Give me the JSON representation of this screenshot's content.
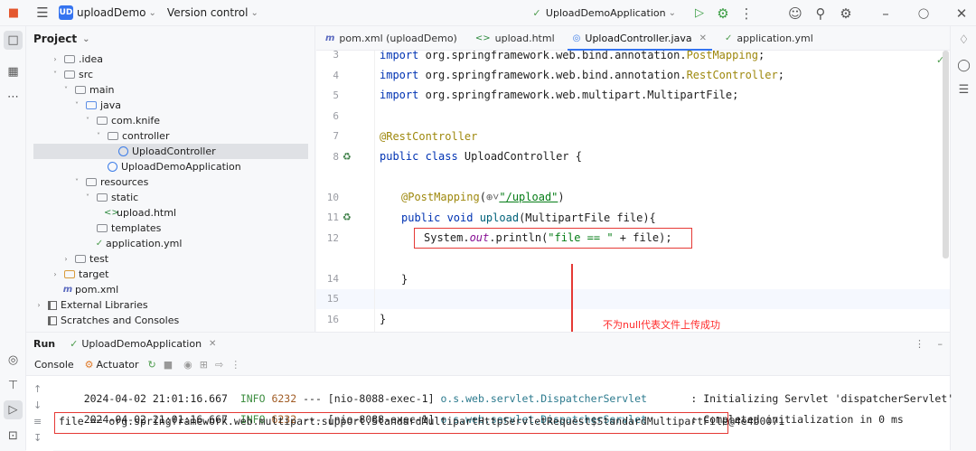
{
  "titlebar": {
    "project_badge": "UD",
    "project_name": "uploadDemo",
    "vcs": "Version control",
    "run_config": "UploadDemoApplication"
  },
  "project_panel": {
    "title": "Project",
    "items": [
      {
        "label": ".idea",
        "type": "folder"
      },
      {
        "label": "src",
        "type": "folder"
      },
      {
        "label": "main",
        "type": "folder"
      },
      {
        "label": "java",
        "type": "folder-blue"
      },
      {
        "label": "com.knife",
        "type": "package"
      },
      {
        "label": "controller",
        "type": "package"
      },
      {
        "label": "UploadController",
        "type": "class",
        "selected": true
      },
      {
        "label": "UploadDemoApplication",
        "type": "class"
      },
      {
        "label": "resources",
        "type": "folder"
      },
      {
        "label": "static",
        "type": "folder"
      },
      {
        "label": "upload.html",
        "type": "html"
      },
      {
        "label": "templates",
        "type": "folder"
      },
      {
        "label": "application.yml",
        "type": "yml"
      },
      {
        "label": "test",
        "type": "folder"
      },
      {
        "label": "target",
        "type": "folder-orange"
      },
      {
        "label": "pom.xml",
        "type": "maven"
      },
      {
        "label": "External Libraries",
        "type": "lib"
      },
      {
        "label": "Scratches and Consoles",
        "type": "scratch"
      }
    ]
  },
  "tabs": [
    {
      "label": "pom.xml (uploadDemo)",
      "icon": "maven-icon"
    },
    {
      "label": "upload.html",
      "icon": "html-icon"
    },
    {
      "label": "UploadController.java",
      "icon": "class-icon",
      "active": true
    },
    {
      "label": "application.yml",
      "icon": "yml-icon"
    }
  ],
  "editor": {
    "line_numbers": [
      "3",
      "4",
      "5",
      "6",
      "7",
      "8",
      "",
      "10",
      "11",
      "12",
      "",
      "14",
      "15",
      "16"
    ],
    "lines": {
      "l3a": "import ",
      "l3b": "org.springframework.web.bind.annotation.",
      "l3c": "PostMapping",
      "l3d": ";",
      "l4a": "import ",
      "l4b": "org.springframework.web.bind.annotation.",
      "l4c": "RestController",
      "l4d": ";",
      "l5a": "import ",
      "l5b": "org.springframework.web.multipart.MultipartFile;",
      "l7": "@RestController",
      "l8a": "public class ",
      "l8b": "UploadController {",
      "l10a": "@PostMapping",
      "l10b": "(",
      "l10c": "⊕˅",
      "l10d": "\"/upload\"",
      "l10e": ")",
      "l11a": "public void ",
      "l11b": "upload",
      "l11c": "(MultipartFile file){",
      "l12a": "System.",
      "l12b": "out",
      "l12c": ".println(",
      "l12d": "\"file == \"",
      "l12e": " + file);",
      "l14": "}",
      "l16": "}"
    }
  },
  "annotation": "不为null代表文件上传成功",
  "run": {
    "title": "Run",
    "config_tab": "UploadDemoApplication",
    "console_tab": "Console",
    "actuator_tab": "Actuator",
    "log1": {
      "ts": "2024-04-02 21:01:16.667",
      "level": "INFO",
      "pid": "6232",
      "thread": "--- [nio-8088-exec-1]",
      "logger": "o.s.web.servlet.DispatcherServlet",
      "msg": ": Initializing Servlet 'dispatcherServlet'"
    },
    "log2": {
      "ts": "2024-04-02 21:01:16.667",
      "level": "INFO",
      "pid": "6232",
      "thread": "--- [nio-8088-exec-1]",
      "logger": "o.s.web.servlet.DispatcherServlet",
      "msg": ": Completed initialization in 0 ms"
    },
    "output": "file == org.springframework.web.multipart.support.StandardMultipartHttpServletRequest$StandardMultipartFile@4e4b0071"
  },
  "colors": {
    "accent": "#3574f0",
    "highlight_box": "#e53935",
    "annotation_text": "#ff2b2b"
  }
}
